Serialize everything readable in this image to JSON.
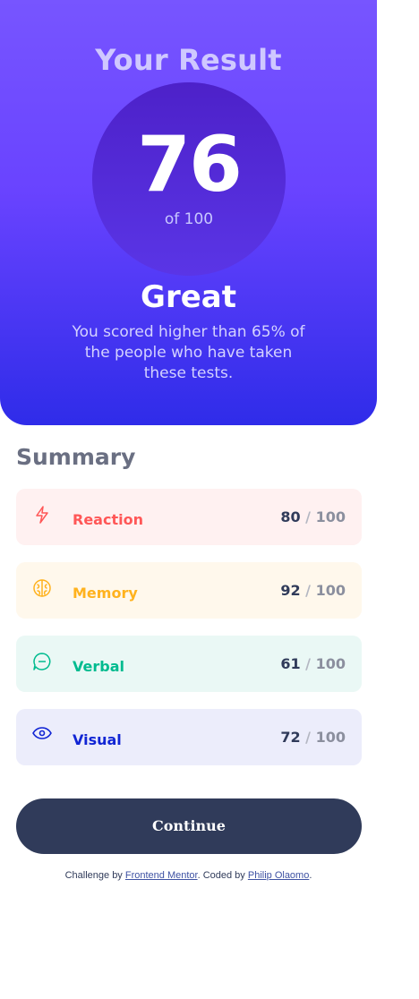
{
  "result": {
    "title": "Your Result",
    "score": "76",
    "of_text": "of 100",
    "grade": "Great",
    "description": "You scored higher than 65% of the people who have taken these tests."
  },
  "summary": {
    "title": "Summary",
    "items": [
      {
        "label": "Reaction",
        "score": "80",
        "max": "100",
        "icon": "lightning-icon",
        "color": "#ff5757"
      },
      {
        "label": "Memory",
        "score": "92",
        "max": "100",
        "icon": "brain-icon",
        "color": "#ffb21e"
      },
      {
        "label": "Verbal",
        "score": "61",
        "max": "100",
        "icon": "chat-bubble-icon",
        "color": "#00bb8f"
      },
      {
        "label": "Visual",
        "score": "72",
        "max": "100",
        "icon": "eye-icon",
        "color": "#1125d4"
      }
    ]
  },
  "continue_button": {
    "label": "Continue"
  },
  "attribution": {
    "prefix": "Challenge by",
    "link1": "Frontend Mentor",
    "middle": ". Coded by",
    "link2": "Philip Olaomo",
    "suffix": "."
  },
  "colors": {
    "gradient_top": "#7755ff",
    "gradient_bottom": "#2f2ce9",
    "dark_navy": "#303b5a"
  }
}
